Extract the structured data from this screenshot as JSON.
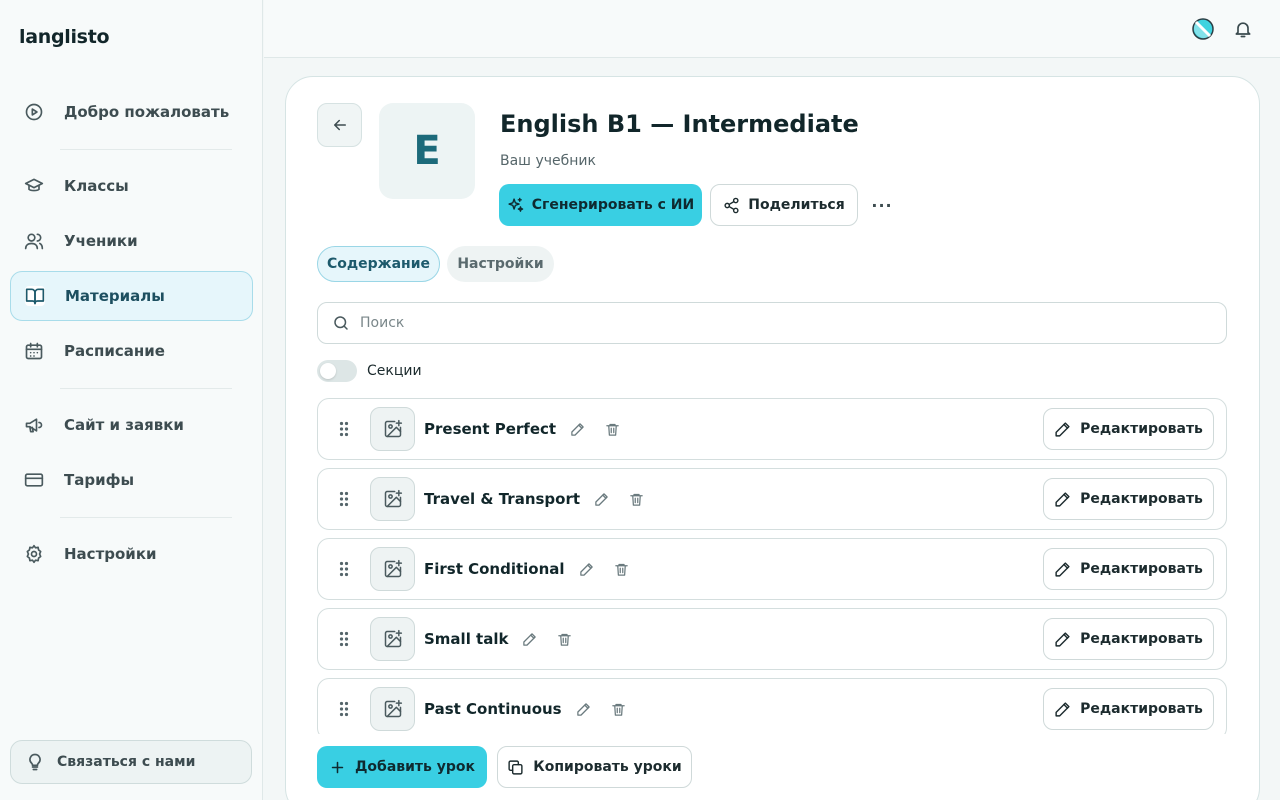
{
  "app": {
    "logo": "langlisto"
  },
  "sidebar": {
    "items": [
      {
        "label": "Добро пожаловать",
        "icon": "play-circle-icon"
      },
      {
        "label": "Классы",
        "icon": "graduation-cap-icon"
      },
      {
        "label": "Ученики",
        "icon": "users-icon"
      },
      {
        "label": "Материалы",
        "icon": "book-open-icon",
        "active": true
      },
      {
        "label": "Расписание",
        "icon": "calendar-icon"
      },
      {
        "label": "Сайт и заявки",
        "icon": "megaphone-icon"
      },
      {
        "label": "Тарифы",
        "icon": "credit-card-icon"
      },
      {
        "label": "Настройки",
        "icon": "gear-icon"
      }
    ],
    "contact_label": "Связаться с нами"
  },
  "course": {
    "avatar_letter": "E",
    "title": "English B1 — Intermediate",
    "subtitle": "Ваш учебник",
    "ai_button": "Сгенерировать с ИИ",
    "share_button": "Поделиться",
    "more_label": "···"
  },
  "tabs": [
    {
      "label": "Содержание",
      "active": true
    },
    {
      "label": "Настройки",
      "active": false
    }
  ],
  "search": {
    "placeholder": "Поиск",
    "value": ""
  },
  "sections_toggle": {
    "label": "Секции",
    "on": false
  },
  "lessons": [
    {
      "name": "Present Perfect",
      "edit_label": "Редактировать"
    },
    {
      "name": "Travel & Transport",
      "edit_label": "Редактировать"
    },
    {
      "name": "First Conditional",
      "edit_label": "Редактировать"
    },
    {
      "name": "Small talk",
      "edit_label": "Редактировать"
    },
    {
      "name": "Past Continuous",
      "edit_label": "Редактировать"
    }
  ],
  "actions": {
    "add_lesson": "Добавить урок",
    "copy_lessons": "Копировать уроки"
  },
  "colors": {
    "accent": "#39cfe3",
    "active_bg": "#e6f6fb",
    "active_border": "#a8dcea"
  }
}
